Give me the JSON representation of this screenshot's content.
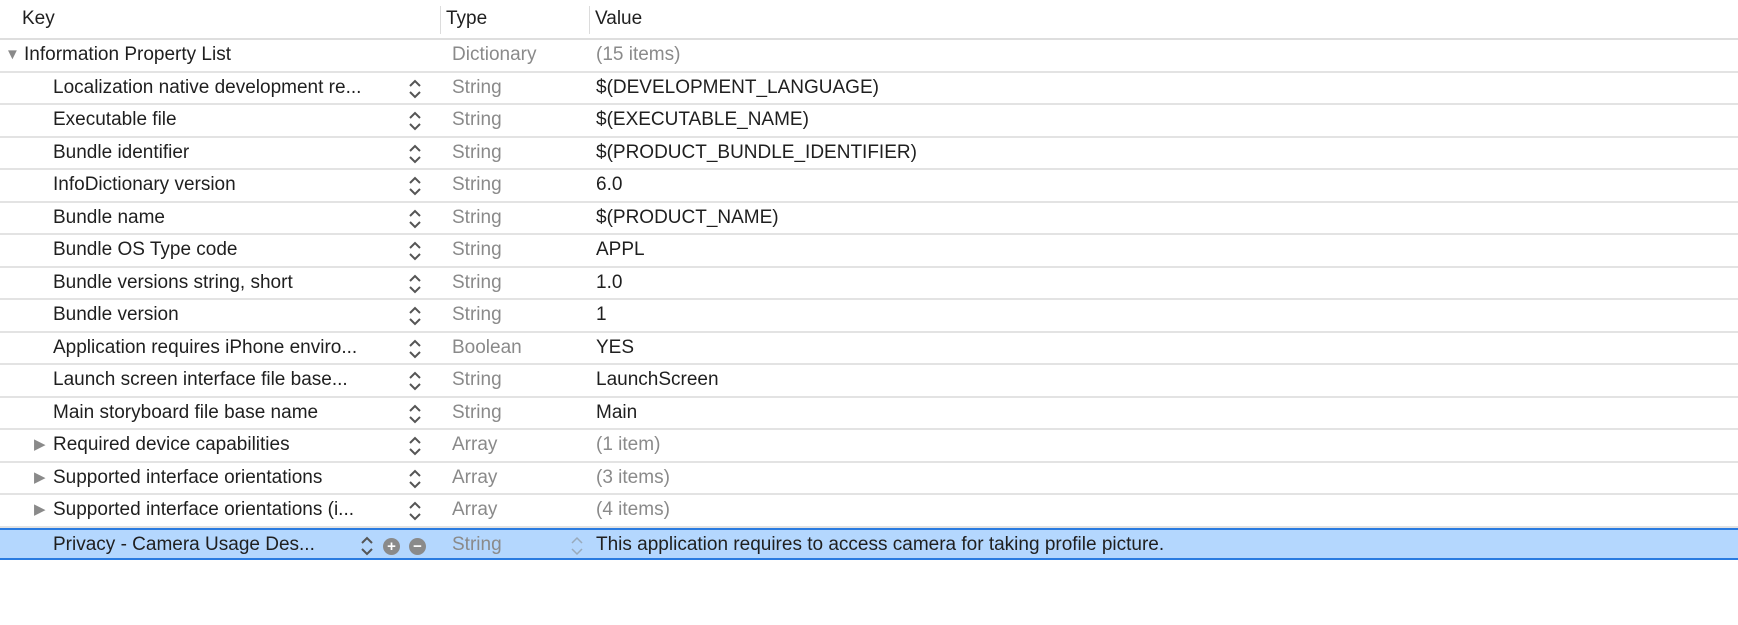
{
  "header": {
    "key": "Key",
    "type": "Type",
    "value": "Value"
  },
  "root": {
    "key": "Information Property List",
    "type": "Dictionary",
    "value": "(15 items)"
  },
  "rows": [
    {
      "key": "Localization native development re...",
      "type": "String",
      "value": "$(DEVELOPMENT_LANGUAGE)"
    },
    {
      "key": "Executable file",
      "type": "String",
      "value": "$(EXECUTABLE_NAME)"
    },
    {
      "key": "Bundle identifier",
      "type": "String",
      "value": "$(PRODUCT_BUNDLE_IDENTIFIER)"
    },
    {
      "key": "InfoDictionary version",
      "type": "String",
      "value": "6.0"
    },
    {
      "key": "Bundle name",
      "type": "String",
      "value": "$(PRODUCT_NAME)"
    },
    {
      "key": "Bundle OS Type code",
      "type": "String",
      "value": "APPL"
    },
    {
      "key": "Bundle versions string, short",
      "type": "String",
      "value": "1.0"
    },
    {
      "key": "Bundle version",
      "type": "String",
      "value": "1"
    },
    {
      "key": "Application requires iPhone enviro...",
      "type": "Boolean",
      "value": "YES"
    },
    {
      "key": "Launch screen interface file base...",
      "type": "String",
      "value": "LaunchScreen"
    },
    {
      "key": "Main storyboard file base name",
      "type": "String",
      "value": "Main"
    },
    {
      "key": "Required device capabilities",
      "type": "Array",
      "value": "(1 item)",
      "expandable": true
    },
    {
      "key": "Supported interface orientations",
      "type": "Array",
      "value": "(3 items)",
      "expandable": true
    },
    {
      "key": "Supported interface orientations (i...",
      "type": "Array",
      "value": "(4 items)",
      "expandable": true
    },
    {
      "key": "Privacy - Camera Usage Des...",
      "type": "String",
      "value": "This application requires to access camera for taking profile picture.",
      "selected": true
    }
  ],
  "colors": {
    "selection": "#b4d7fe",
    "selection_border": "#2a7be0"
  }
}
